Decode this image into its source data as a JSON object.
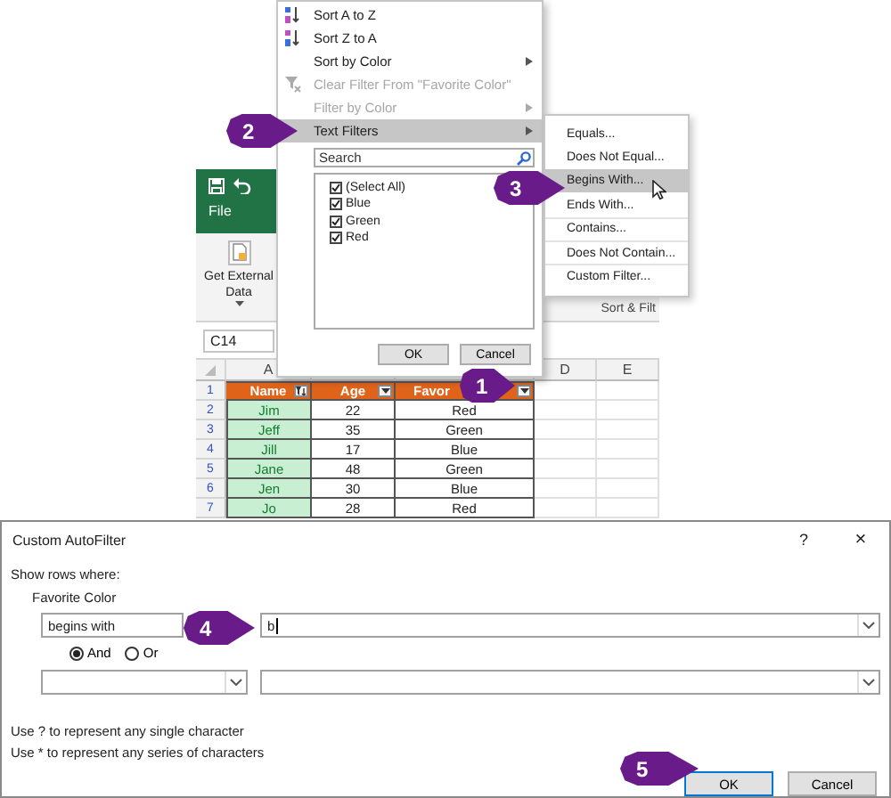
{
  "spreadsheet": {
    "ribbon_tab": "File",
    "ribbon_command": "Get External Data",
    "ribbon_group": "Sort & Filt",
    "name_box": "C14",
    "column_letters": [
      "A",
      "D",
      "E"
    ],
    "header_row": {
      "number": "1",
      "cells": [
        {
          "label": "Name",
          "filtered": true
        },
        {
          "label": "Age",
          "filtered": false
        },
        {
          "label": "Favor",
          "filtered": false
        }
      ]
    },
    "rows": [
      {
        "number": "2",
        "cells": [
          "Jim",
          "22",
          "Red"
        ]
      },
      {
        "number": "3",
        "cells": [
          "Jeff",
          "35",
          "Green"
        ]
      },
      {
        "number": "4",
        "cells": [
          "Jill",
          "17",
          "Blue"
        ]
      },
      {
        "number": "5",
        "cells": [
          "Jane",
          "48",
          "Green"
        ]
      },
      {
        "number": "6",
        "cells": [
          "Jen",
          "30",
          "Blue"
        ]
      },
      {
        "number": "7",
        "cells": [
          "Jo",
          "28",
          "Red"
        ]
      }
    ]
  },
  "filter_menu": {
    "items": [
      {
        "label": "Sort A to Z",
        "submenu": false,
        "disabled": false,
        "selected": false
      },
      {
        "label": "Sort Z to A",
        "submenu": false,
        "disabled": false,
        "selected": false
      },
      {
        "label": "Sort by Color",
        "submenu": true,
        "disabled": false,
        "selected": false
      },
      {
        "label": "Clear Filter From \"Favorite Color\"",
        "submenu": false,
        "disabled": true,
        "selected": false
      },
      {
        "label": "Filter by Color",
        "submenu": true,
        "disabled": true,
        "selected": false
      },
      {
        "label": "Text Filters",
        "submenu": true,
        "disabled": false,
        "selected": true
      }
    ],
    "search": {
      "placeholder": "Search"
    },
    "values": [
      {
        "label": "(Select All)",
        "checked": true
      },
      {
        "label": "Blue",
        "checked": true
      },
      {
        "label": "Green",
        "checked": true
      },
      {
        "label": "Red",
        "checked": true
      }
    ],
    "buttons": [
      "OK",
      "Cancel"
    ]
  },
  "text_filters_menu": {
    "items": [
      {
        "label": "Equals...",
        "selected": false
      },
      {
        "label": "Does Not Equal...",
        "selected": false
      },
      {
        "label": "Begins With...",
        "selected": true
      },
      {
        "label": "Ends With...",
        "selected": false
      },
      {
        "label": "Contains...",
        "selected": false
      },
      {
        "label": "Does Not Contain...",
        "selected": false
      },
      {
        "label": "Custom Filter...",
        "selected": false
      }
    ]
  },
  "dialog": {
    "title": "Custom AutoFilter",
    "help": "?",
    "close": "×",
    "intro": "Show rows where:",
    "field": "Favorite Color",
    "criteria": [
      {
        "operator": "begins with",
        "value": "b"
      }
    ],
    "logic": [
      {
        "label": "And",
        "selected": true
      },
      {
        "label": "Or",
        "selected": false
      }
    ],
    "hints": [
      "Use ? to represent any single character",
      "Use * to represent any series of characters"
    ],
    "buttons": [
      {
        "label": "OK",
        "default": true
      },
      {
        "label": "Cancel",
        "default": false
      }
    ]
  },
  "callouts": [
    "1",
    "2",
    "3",
    "4",
    "5"
  ]
}
